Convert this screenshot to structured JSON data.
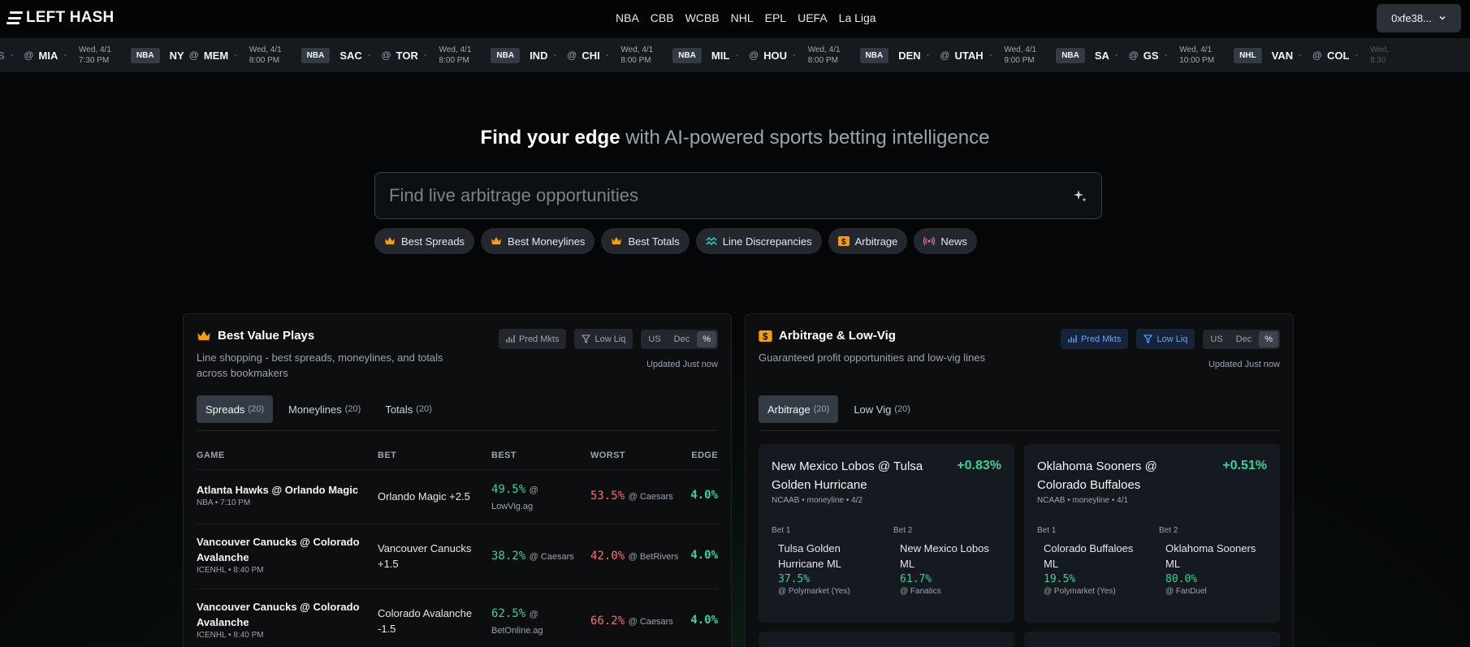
{
  "brand": "LEFT HASH",
  "nav": [
    "NBA",
    "CBB",
    "WCBB",
    "NHL",
    "EPL",
    "UEFA",
    "La Liga"
  ],
  "wallet": "0xfe38...",
  "ticker": [
    {
      "league": "",
      "away": "S",
      "home": "MIA",
      "date": "Wed, 4/1",
      "time": "7:30 PM"
    },
    {
      "league": "NBA",
      "away": "NY",
      "home": "MEM",
      "date": "Wed, 4/1",
      "time": "8:00 PM"
    },
    {
      "league": "NBA",
      "away": "SAC",
      "home": "TOR",
      "date": "Wed, 4/1",
      "time": "8:00 PM"
    },
    {
      "league": "NBA",
      "away": "IND",
      "home": "CHI",
      "date": "Wed, 4/1",
      "time": "8:00 PM"
    },
    {
      "league": "NBA",
      "away": "MIL",
      "home": "HOU",
      "date": "Wed, 4/1",
      "time": "8:00 PM"
    },
    {
      "league": "NBA",
      "away": "DEN",
      "home": "UTAH",
      "date": "Wed, 4/1",
      "time": "9:00 PM"
    },
    {
      "league": "NBA",
      "away": "SA",
      "home": "GS",
      "date": "Wed, 4/1",
      "time": "10:00 PM"
    },
    {
      "league": "NHL",
      "away": "VAN",
      "home": "COL",
      "date": "Wed,",
      "time": "8:30"
    }
  ],
  "hero": {
    "bold": "Find your edge",
    "rest": " with AI-powered sports betting intelligence"
  },
  "search": {
    "placeholder": "Find live arbitrage opportunities"
  },
  "chips": [
    {
      "label": "Best Spreads",
      "icon": "crown-icon"
    },
    {
      "label": "Best Moneylines",
      "icon": "crown-icon"
    },
    {
      "label": "Best Totals",
      "icon": "crown-icon"
    },
    {
      "label": "Line Discrepancies",
      "icon": "trend-icon"
    },
    {
      "label": "Arbitrage",
      "icon": "dollar-icon"
    },
    {
      "label": "News",
      "icon": "broadcast-icon"
    }
  ],
  "left": {
    "title": "Best Value Plays",
    "subtitle": "Line shopping - best spreads, moneylines, and totals across bookmakers",
    "pred_mkts": "Pred Mkts",
    "low_liq": "Low Liq",
    "fmt": [
      "US",
      "Dec",
      "%"
    ],
    "updated": "Updated Just now",
    "tabs": [
      {
        "label": "Spreads",
        "count": "(20)"
      },
      {
        "label": "Moneylines",
        "count": "(20)"
      },
      {
        "label": "Totals",
        "count": "(20)"
      }
    ],
    "columns": [
      "GAME",
      "BET",
      "BEST",
      "WORST",
      "EDGE"
    ],
    "rows": [
      {
        "game": "Atlanta Hawks @ Orlando Magic",
        "meta": "NBA • 7:10 PM",
        "bet": "Orlando Magic +2.5",
        "best": "49.5%",
        "best_bk": "@",
        "best_bk2": "LowVig.ag",
        "worst": "53.5%",
        "worst_bk": "@ Caesars",
        "edge": "4.0%"
      },
      {
        "game": "Vancouver Canucks @ Colorado Avalanche",
        "meta": "ICENHL • 8:40 PM",
        "bet": "Vancouver Canucks +1.5",
        "best": "38.2%",
        "best_bk": "@ Caesars",
        "best_bk2": "",
        "worst": "42.0%",
        "worst_bk": "@ BetRivers",
        "edge": "4.0%"
      },
      {
        "game": "Vancouver Canucks @ Colorado Avalanche",
        "meta": "ICENHL • 8:40 PM",
        "bet": "Colorado Avalanche -1.5",
        "best": "62.5%",
        "best_bk": "@",
        "best_bk2": "BetOnline.ag",
        "worst": "66.2%",
        "worst_bk": "@ Caesars",
        "edge": "4.0%"
      }
    ]
  },
  "right": {
    "title": "Arbitrage & Low-Vig",
    "subtitle": "Guaranteed profit opportunities and low-vig lines",
    "pred_mkts": "Pred Mkts",
    "low_liq": "Low Liq",
    "fmt": [
      "US",
      "Dec",
      "%"
    ],
    "updated": "Updated Just now",
    "tabs": [
      {
        "label": "Arbitrage",
        "count": "(20)"
      },
      {
        "label": "Low Vig",
        "count": "(20)"
      }
    ],
    "cards": [
      {
        "title": "New Mexico Lobos @ Tulsa Golden Hurricane",
        "profit": "+0.83%",
        "meta": "NCAAB • moneyline • 4/2",
        "bet1": {
          "label": "Bet 1",
          "team": "Tulsa Golden Hurricane ML",
          "pct": "37.5%",
          "book": "@ Polymarket (Yes)"
        },
        "bet2": {
          "label": "Bet 2",
          "team": "New Mexico Lobos ML",
          "pct": "61.7%",
          "book": "@ Fanatics"
        }
      },
      {
        "title": "Oklahoma Sooners @ Colorado Buffaloes",
        "profit": "+0.51%",
        "meta": "NCAAB • moneyline • 4/1",
        "bet1": {
          "label": "Bet 1",
          "team": "Colorado Buffaloes ML",
          "pct": "19.5%",
          "book": "@ Polymarket (Yes)"
        },
        "bet2": {
          "label": "Bet 2",
          "team": "Oklahoma Sooners ML",
          "pct": "80.0%",
          "book": "@ FanDuel"
        }
      }
    ]
  },
  "colors": {
    "accent_green": "#34d399",
    "accent_red": "#f87171",
    "accent_blue": "#60a5fa",
    "crown": "#f59e0b"
  }
}
